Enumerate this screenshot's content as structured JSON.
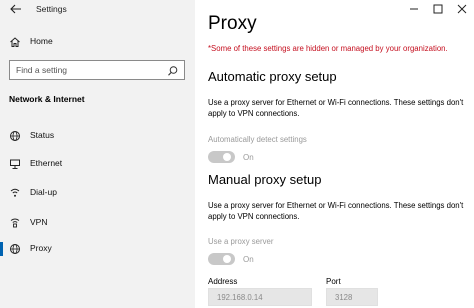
{
  "app": {
    "title": "Settings"
  },
  "sidebar": {
    "home_label": "Home",
    "search_placeholder": "Find a setting",
    "section_heading": "Network & Internet",
    "items": [
      {
        "label": "Status",
        "icon": "globe-icon"
      },
      {
        "label": "Ethernet",
        "icon": "ethernet-icon"
      },
      {
        "label": "Dial-up",
        "icon": "dialup-icon"
      },
      {
        "label": "VPN",
        "icon": "vpn-icon"
      },
      {
        "label": "Proxy",
        "icon": "proxy-icon",
        "selected": true
      }
    ]
  },
  "main": {
    "title": "Proxy",
    "managed_warning": "*Some of these settings are hidden or managed by your organization.",
    "automatic": {
      "heading": "Automatic proxy setup",
      "description": "Use a proxy server for Ethernet or Wi-Fi connections. These settings don't apply to VPN connections.",
      "detect_label": "Automatically detect settings",
      "detect_state": "On",
      "detect_on": true
    },
    "manual": {
      "heading": "Manual proxy setup",
      "description": "Use a proxy server for Ethernet or Wi-Fi connections. These settings don't apply to VPN connections.",
      "use_proxy_label": "Use a proxy server",
      "use_proxy_state": "On",
      "use_proxy_on": true,
      "address_label": "Address",
      "address_value": "192.168.0.14",
      "port_label": "Port",
      "port_value": "3128"
    }
  },
  "colors": {
    "warning": "#c50f1f",
    "accent": "#0063b1",
    "sidebar_bg": "#f2f2f2",
    "disabled_text": "#9a9a9a"
  }
}
